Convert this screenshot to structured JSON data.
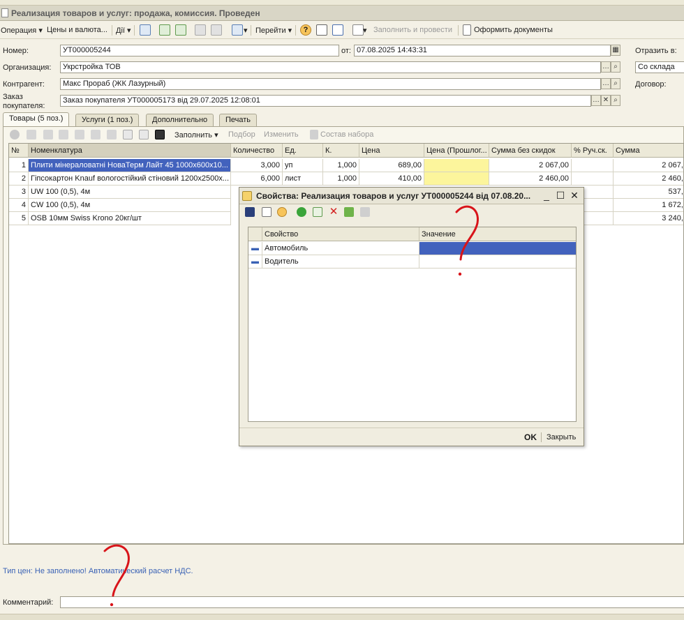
{
  "window": {
    "title": "Реализация товаров и услуг: продажа, комиссия. Проведен"
  },
  "toolbar": {
    "operation": "Операция",
    "prices_currency": "Цены и валюта...",
    "actions": "Дії",
    "goto": "Перейти",
    "fill_post": "Заполнить и провести",
    "make_docs": "Оформить документы"
  },
  "form": {
    "number_label": "Номер:",
    "number_value": "УТ000005244",
    "date_label": "от:",
    "date_value": "07.08.2025 14:43:31",
    "reflect_label": "Отразить в:",
    "org_label": "Организация:",
    "org_value": "Укрстройка ТОВ",
    "warehouse_value": "Со склада",
    "counterparty_label": "Контрагент:",
    "counterparty_value": "Макс Прораб (ЖК Лазурный)",
    "contract_label": "Договор:",
    "order_label_1": "Заказ",
    "order_label_2": "покупателя:",
    "order_value": "Заказ покупателя УТ000005173 від 29.07.2025 12:08:01"
  },
  "tabs": [
    {
      "label": "Товары (5 поз.)"
    },
    {
      "label": "Услуги (1 поз.)"
    },
    {
      "label": "Дополнительно"
    },
    {
      "label": "Печать"
    }
  ],
  "grid_toolbar": {
    "fill": "Заполнить",
    "pick": "Подбор",
    "change": "Изменить",
    "set_composition": "Состав набора"
  },
  "grid": {
    "headers": [
      "№",
      "Номенклатура",
      "Количество",
      "Ед.",
      "К.",
      "Цена",
      "Цена (Прошлог...",
      "Сумма без скидок",
      "% Руч.ск.",
      "Сумма"
    ],
    "rows": [
      {
        "n": "1",
        "name": "Плити мінераловатні НоваТерм Лайт 45 1000х600х10...",
        "qty": "3,000",
        "unit": "уп",
        "k": "1,000",
        "price": "689,00",
        "sum_nodisc": "2 067,00",
        "sum": "2 067,0"
      },
      {
        "n": "2",
        "name": "Гіпсокартон Knauf вологостійкий стіновий 1200х2500х...",
        "qty": "6,000",
        "unit": "лист",
        "k": "1,000",
        "price": "410,00",
        "sum_nodisc": "2 460,00",
        "sum": "2 460,0"
      },
      {
        "n": "3",
        "name": "UW 100 (0,5), 4м",
        "qty": "",
        "unit": "",
        "k": "",
        "price": "",
        "sum_nodisc": "",
        "sum": "537,0"
      },
      {
        "n": "4",
        "name": "CW 100 (0,5), 4м",
        "qty": "",
        "unit": "",
        "k": "",
        "price": "",
        "sum_nodisc": "",
        "sum": "1 672,0"
      },
      {
        "n": "5",
        "name": "OSB  10мм Swiss Krono 20кг/шт",
        "qty": "",
        "unit": "",
        "k": "",
        "price": "",
        "sum_nodisc": "",
        "sum": "3 240,0"
      }
    ]
  },
  "info": {
    "price_type_text": "Тип цен: Не заполнено! Автоматический расчет НДС."
  },
  "comment": {
    "label": "Комментарий:",
    "value": ""
  },
  "dialog": {
    "title": "Свойства: Реализация товаров и услуг УТ000005244 від 07.08.20...",
    "col_property": "Свойство",
    "col_value": "Значение",
    "rows": [
      {
        "property": "Автомобиль",
        "value": ""
      },
      {
        "property": "Водитель",
        "value": ""
      }
    ],
    "ok": "OK",
    "close": "Закрыть"
  },
  "colors": {
    "selection": "#4262bd",
    "price_highlight": "#fcf59c",
    "annotation": "#d8141a",
    "info_text": "#3a62b5"
  }
}
